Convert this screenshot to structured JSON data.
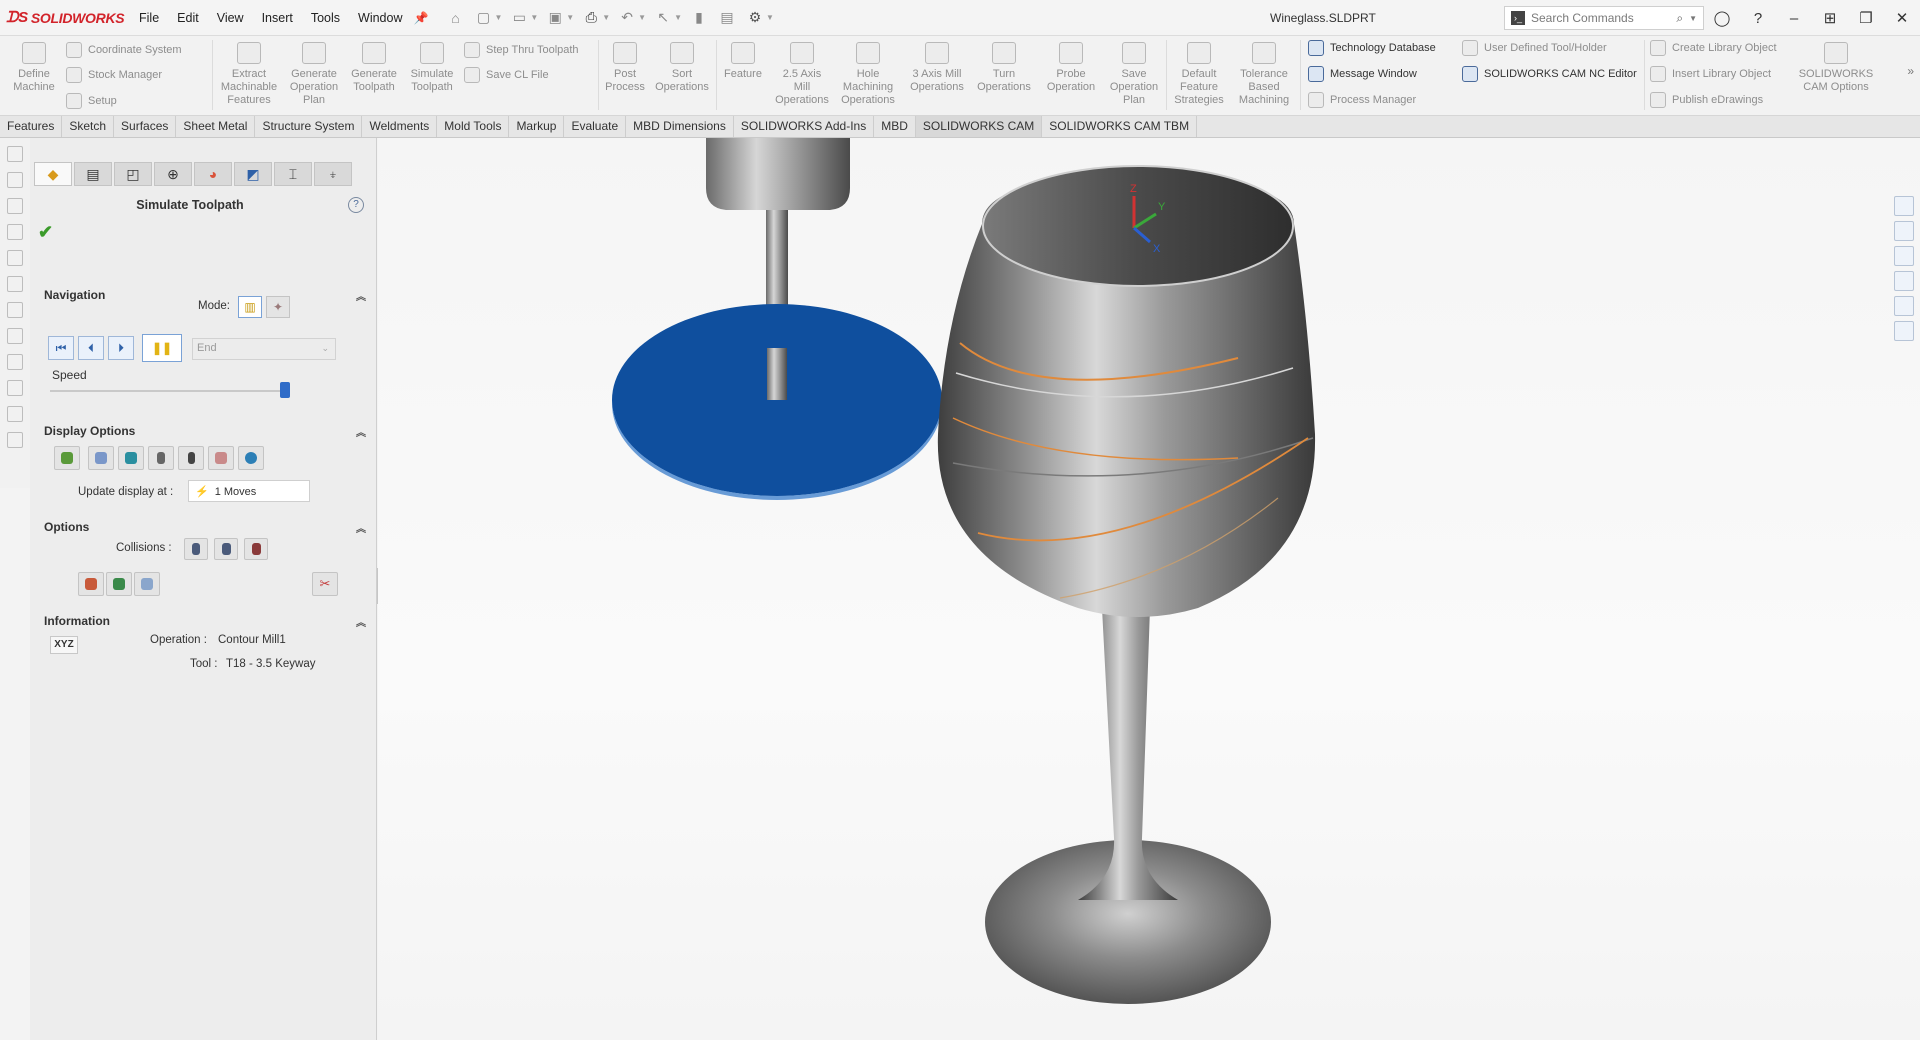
{
  "app": {
    "brand": "SOLIDWORKS",
    "menu": [
      "File",
      "Edit",
      "View",
      "Insert",
      "Tools",
      "Window"
    ],
    "document_title": "Wineglass.SLDPRT",
    "search_placeholder": "Search Commands"
  },
  "commands": {
    "define_machine": "Define Machine",
    "coordinate_system": "Coordinate System",
    "stock_manager": "Stock Manager",
    "setup": "Setup",
    "extract_features": "Extract Machinable Features",
    "generate_operation_plan": "Generate Operation Plan",
    "generate_toolpath": "Generate Toolpath",
    "simulate_toolpath": "Simulate Toolpath",
    "step_thru_toolpath": "Step Thru Toolpath",
    "save_cl_file": "Save CL File",
    "post_process": "Post Process",
    "sort_operations": "Sort Operations",
    "feature": "Feature",
    "axis25_mill": "2.5 Axis Mill Operations",
    "hole_machining": "Hole Machining Operations",
    "axis3_mill": "3 Axis Mill Operations",
    "turn_operations": "Turn Operations",
    "probe_operation": "Probe Operation",
    "save_operation_plan": "Save Operation Plan",
    "default_feature_strategies": "Default Feature Strategies",
    "tolerance_based": "Tolerance Based Machining",
    "technology_database": "Technology Database",
    "message_window": "Message Window",
    "process_manager": "Process Manager",
    "user_defined_tool": "User Defined Tool/Holder",
    "nc_editor": "SOLIDWORKS CAM NC Editor",
    "create_library_object": "Create Library Object",
    "insert_library_object": "Insert Library Object",
    "publish_edrawings": "Publish eDrawings",
    "cam_options": "SOLIDWORKS CAM Options"
  },
  "tabs": [
    "Features",
    "Sketch",
    "Surfaces",
    "Sheet Metal",
    "Structure System",
    "Weldments",
    "Mold Tools",
    "Markup",
    "Evaluate",
    "MBD Dimensions",
    "SOLIDWORKS Add-Ins",
    "MBD",
    "SOLIDWORKS CAM",
    "SOLIDWORKS CAM TBM"
  ],
  "selected_tab": "SOLIDWORKS CAM",
  "panel": {
    "title": "Simulate Toolpath",
    "navigation": {
      "header": "Navigation",
      "mode_label": "Mode:",
      "end_option": "End",
      "speed_label": "Speed",
      "speed_level": 1.0
    },
    "display_options": {
      "header": "Display Options",
      "update_label": "Update display at :",
      "update_value": "1 Moves"
    },
    "options": {
      "header": "Options",
      "collisions_label": "Collisions :"
    },
    "information": {
      "header": "Information",
      "xyz": "XYZ",
      "operation_label": "Operation :",
      "operation_value": "Contour Mill1",
      "tool_label": "Tool :",
      "tool_value": "T18 - 3.5 Keyway"
    }
  },
  "viewport": {
    "axes": {
      "x": "X",
      "y": "Y",
      "z": "Z"
    }
  },
  "colors": {
    "brand_red": "#d2232a",
    "cutter_blue": "#0f4f9e",
    "toolpath_orange": "#e08a3c",
    "accent_blue": "#2f6cc8"
  }
}
